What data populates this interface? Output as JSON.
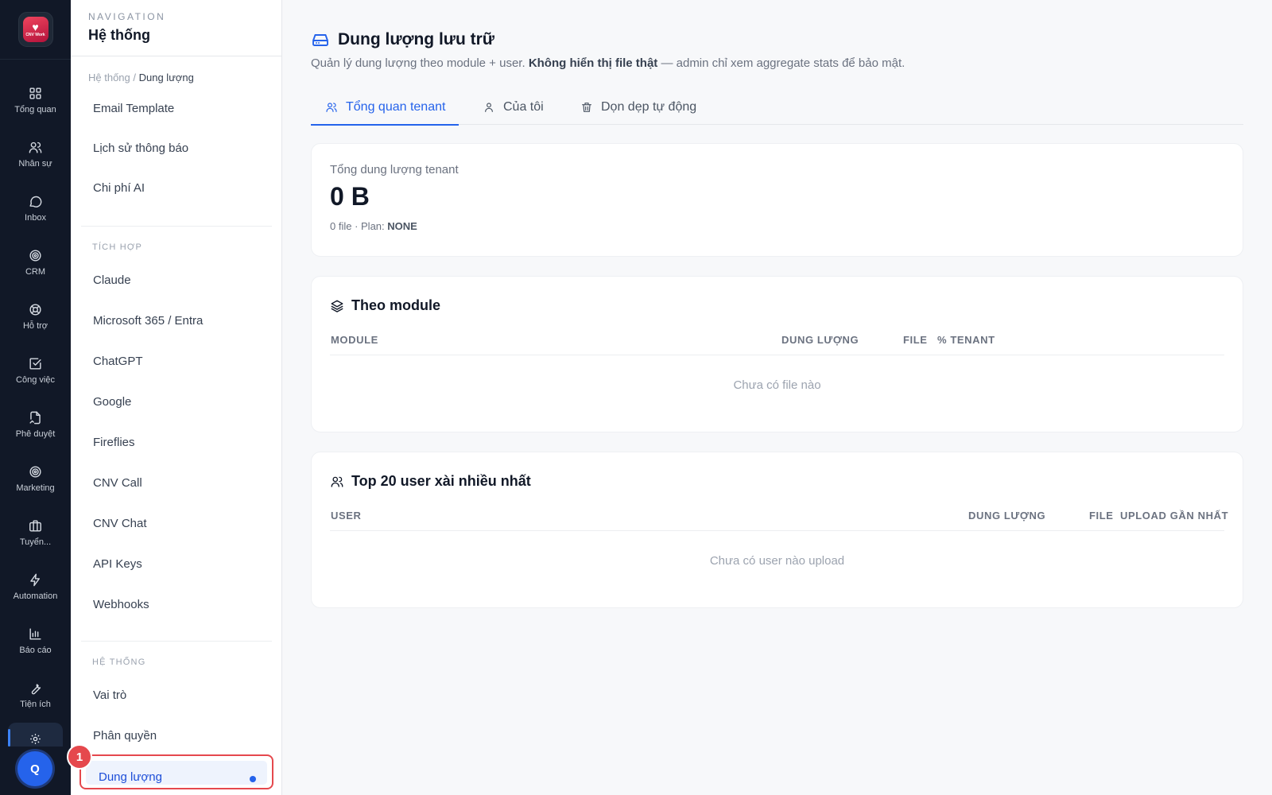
{
  "rail": {
    "logo_text": "CNV Work",
    "items": [
      {
        "label": "Tổng quan",
        "icon": "dashboard-icon"
      },
      {
        "label": "Nhân sự",
        "icon": "users-icon"
      },
      {
        "label": "Inbox",
        "icon": "chat-icon"
      },
      {
        "label": "CRM",
        "icon": "target-icon"
      },
      {
        "label": "Hỗ trợ",
        "icon": "lifebuoy-icon"
      },
      {
        "label": "Công việc",
        "icon": "checkbox-icon"
      },
      {
        "label": "Phê duyệt",
        "icon": "file-sign-icon"
      },
      {
        "label": "Marketing",
        "icon": "target-icon"
      },
      {
        "label": "Tuyển...",
        "icon": "briefcase-icon"
      },
      {
        "label": "Automation",
        "icon": "bolt-icon"
      },
      {
        "label": "Báo cáo",
        "icon": "bar-chart-icon"
      },
      {
        "label": "Tiện ích",
        "icon": "wrench-icon"
      }
    ],
    "active_icon": "gear-icon",
    "avatar_initial": "Q"
  },
  "nav": {
    "eyebrow": "NAVIGATION",
    "title": "Hệ thống",
    "breadcrumb": {
      "parent": "Hệ thống",
      "separator": " / ",
      "current": "Dung lượng"
    },
    "group_top": [
      "Email Template",
      "Lịch sử thông báo",
      "Chi phí AI"
    ],
    "section_integrations": "TÍCH HỢP",
    "integrations": [
      "Claude",
      "Microsoft 365 / Entra",
      "ChatGPT",
      "Google",
      "Fireflies",
      "CNV Call",
      "CNV Chat",
      "API Keys",
      "Webhooks"
    ],
    "section_system": "HỆ THỐNG",
    "system": [
      "Vai trò",
      "Phân quyền"
    ],
    "active_item": "Dung lượng",
    "step_badge": "1"
  },
  "page": {
    "title": "Dung lượng lưu trữ",
    "subtitle_pre": "Quản lý dung lượng theo module + user. ",
    "subtitle_bold": "Không hiển thị file thật",
    "subtitle_post": " — admin chỉ xem aggregate stats để bảo mật.",
    "tabs": [
      {
        "label": "Tổng quan tenant",
        "icon": "users-icon",
        "active": true
      },
      {
        "label": "Của tôi",
        "icon": "user-icon",
        "active": false
      },
      {
        "label": "Dọn dẹp tự động",
        "icon": "trash-icon",
        "active": false
      }
    ]
  },
  "summary": {
    "label": "Tổng dung lượng tenant",
    "value": "0 B",
    "meta_pre": "0 file · Plan: ",
    "plan": "NONE"
  },
  "modules": {
    "title": "Theo module",
    "columns": [
      "MODULE",
      "DUNG LƯỢNG",
      "FILE",
      "% TENANT"
    ],
    "empty": "Chưa có file nào"
  },
  "top_users": {
    "title": "Top 20 user xài nhiều nhất",
    "columns": [
      "USER",
      "DUNG LƯỢNG",
      "FILE",
      "UPLOAD GẦN NHẤT"
    ],
    "empty": "Chưa có user nào upload"
  },
  "colors": {
    "accent": "#2563eb",
    "rail_bg": "#111827",
    "highlight": "#e5484d"
  }
}
